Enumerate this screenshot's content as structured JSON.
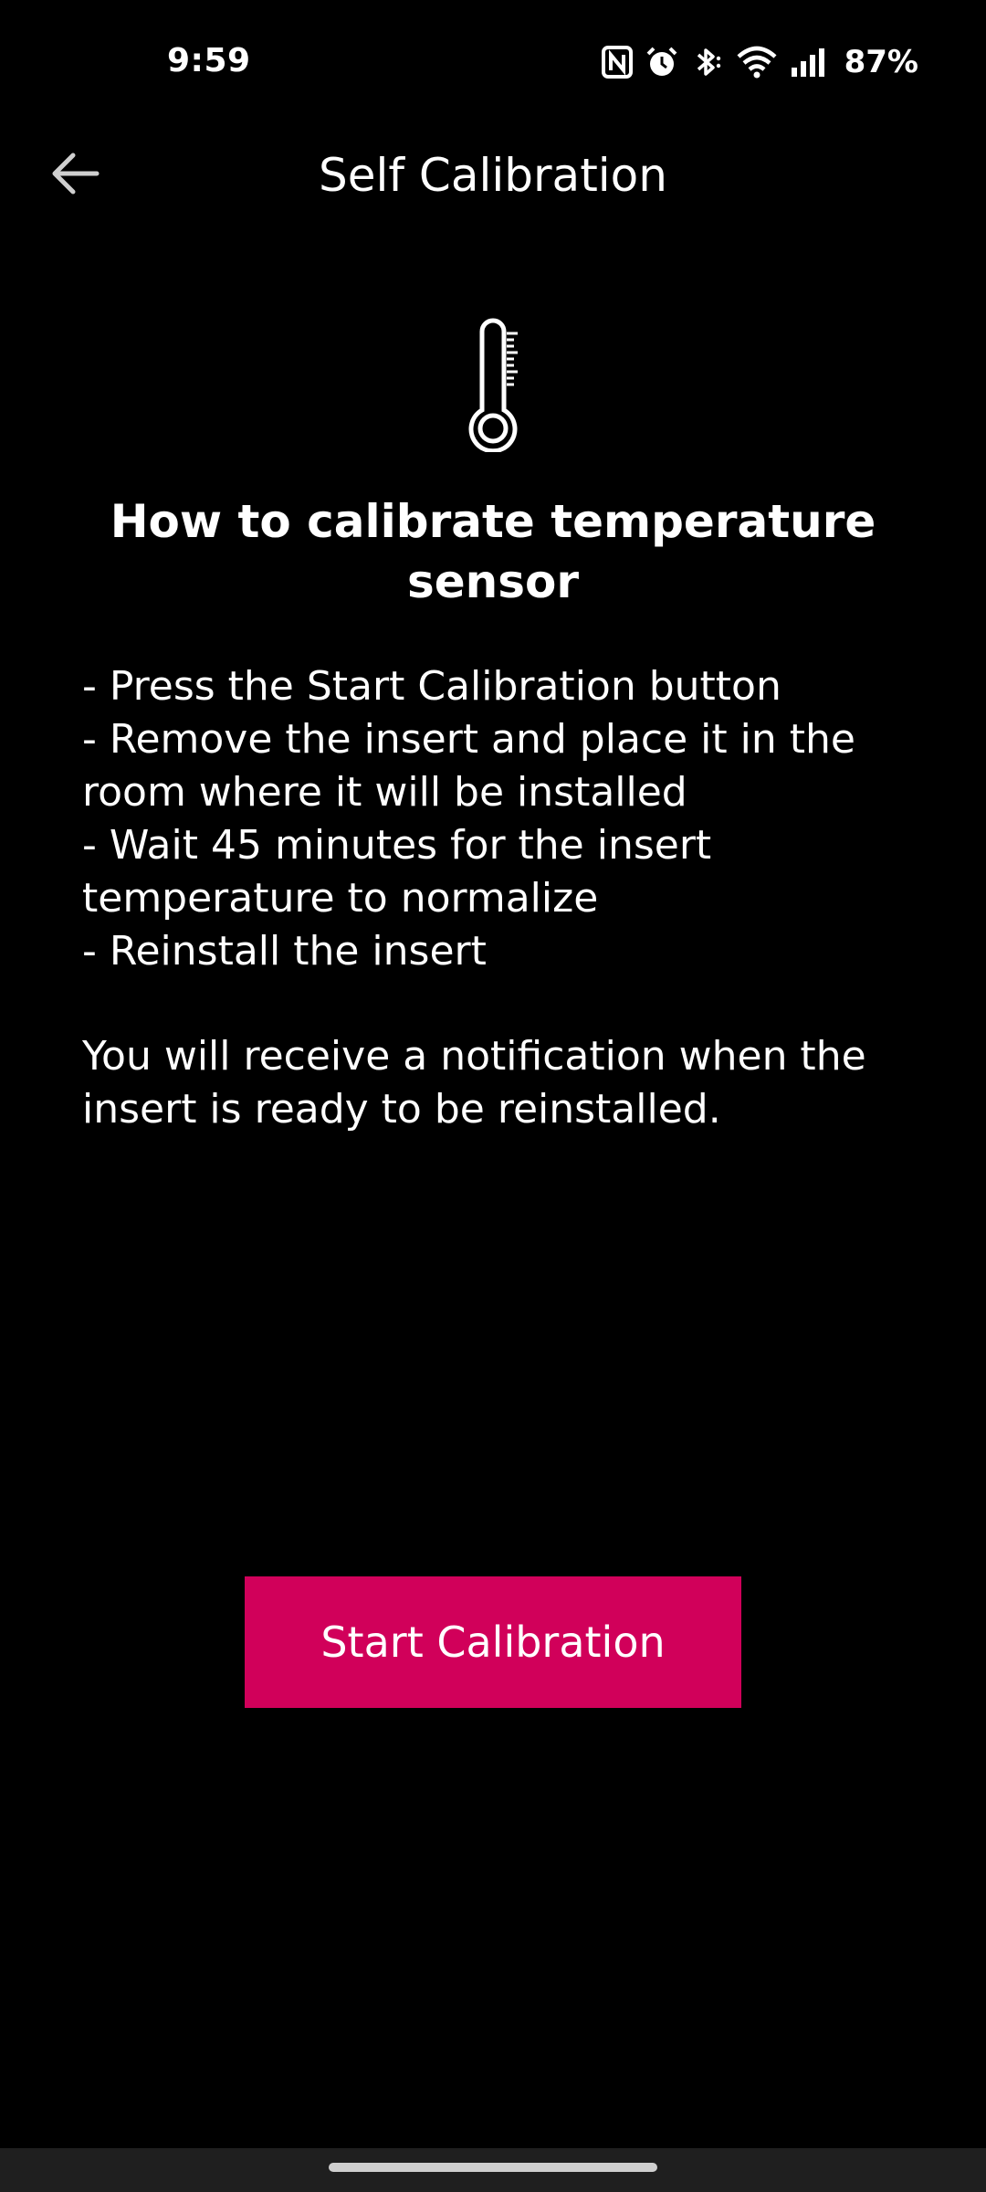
{
  "status_bar": {
    "time": "9:59",
    "battery_percent": "87%",
    "icons": [
      "nfc-icon",
      "alarm-icon",
      "bluetooth-icon",
      "wifi-icon",
      "signal-icon"
    ]
  },
  "app_bar": {
    "title": "Self Calibration",
    "back_icon": "back-arrow-icon"
  },
  "content": {
    "icon": "thermometer-icon",
    "heading": "How to calibrate temperature sensor",
    "steps": [
      "- Press the Start Calibration button",
      "- Remove the insert and place it in the room where it will be installed",
      "- Wait 45 minutes for the insert temperature to normalize",
      "- Reinstall the insert"
    ],
    "notice": "You will receive a notification when the insert is ready to be reinstalled."
  },
  "actions": {
    "start_label": "Start Calibration"
  },
  "colors": {
    "background": "#000000",
    "accent": "#d1005a",
    "text": "#ffffff"
  }
}
